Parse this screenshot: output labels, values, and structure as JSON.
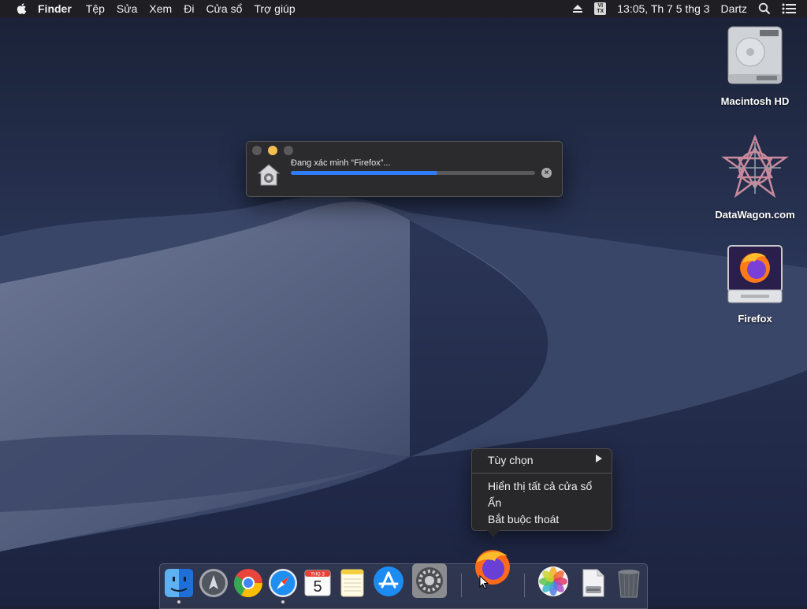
{
  "menubar": {
    "apple_icon": "apple-logo-icon",
    "app_name": "Finder",
    "items": [
      "Tệp",
      "Sửa",
      "Xem",
      "Đi",
      "Cửa sổ",
      "Trợ giúp"
    ],
    "input_source_top": "VI",
    "input_source_bottom": "TX",
    "clock": "13:05, Th 7 5 thg 3",
    "user": "Dartz",
    "status_icons": [
      "eject-icon",
      "input-source-icon",
      "spotlight-search-icon",
      "notification-center-icon"
    ]
  },
  "desktop_icons": [
    {
      "label": "Macintosh HD",
      "icon": "hard-drive-icon"
    },
    {
      "label": "DataWagon.com",
      "icon": "datawagon-logo-icon"
    },
    {
      "label": "Firefox",
      "icon": "firefox-disk-image-icon"
    }
  ],
  "verify_window": {
    "text": "Đang xác minh “Firefox”...",
    "progress": 0.6,
    "icon": "gatekeeper-house-icon"
  },
  "context_menu": {
    "items": [
      {
        "label": "Tùy chọn",
        "submenu": true
      },
      {
        "label": "Hiển thị tất cả cửa sổ"
      },
      {
        "label": "Ẩn"
      },
      {
        "label": "Bắt buộc thoát"
      }
    ]
  },
  "calendar": {
    "month": "THG 3",
    "day": "5"
  },
  "dock": {
    "apps": [
      "Finder",
      "Launchpad",
      "Google Chrome",
      "Safari",
      "Lịch",
      "Ghi chú",
      "App Store",
      "Tùy chọn Hệ thống",
      "Firefox",
      "Ảnh",
      "Trình xem trước",
      "Thùng rác"
    ]
  },
  "colors": {
    "accent": "#2f7cf6",
    "minimize": "#f5bf4f",
    "menu_bg": "#28282a"
  }
}
